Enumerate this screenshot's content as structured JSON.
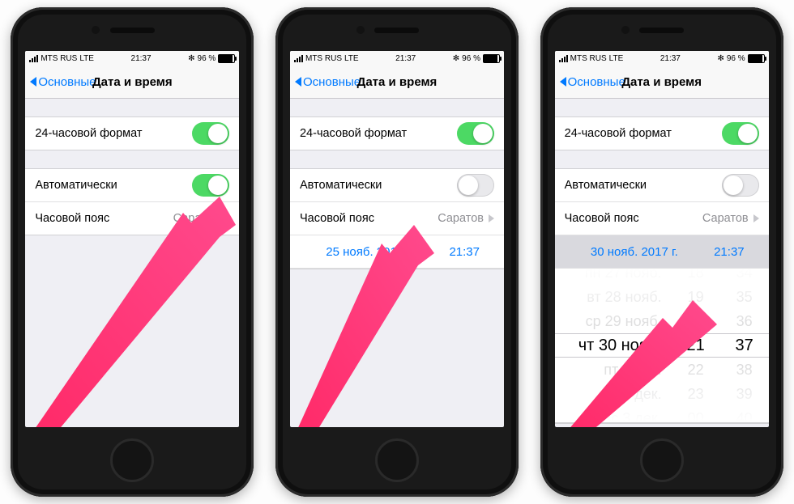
{
  "status_bar": {
    "carrier": "MTS RUS",
    "network": "LTE",
    "time": "21:37",
    "battery_pct": "96 %",
    "bluetooth": "✻"
  },
  "nav": {
    "back_label": "Основные",
    "title": "Дата и время"
  },
  "settings": {
    "twenty_four_hour_label": "24-часовой формат",
    "automatic_label": "Автоматически",
    "timezone_label": "Часовой пояс",
    "timezone_value": "Саратов"
  },
  "phone2_datetime": {
    "date": "25 нояб. 2017 г.",
    "time": "21:37"
  },
  "phone3_datetime": {
    "date": "30 нояб. 2017 г.",
    "time": "21:37"
  },
  "picker": {
    "dates": [
      "пн 27 нояб.",
      "вт 28 нояб.",
      "ср 29 нояб.",
      "чт 30 нояб.",
      "пт 1 дек.",
      "сб 2 дек.",
      "вс 3 дек."
    ],
    "hours": [
      "18",
      "19",
      "20",
      "21",
      "22",
      "23",
      "00"
    ],
    "minutes": [
      "34",
      "35",
      "36",
      "37",
      "38",
      "39",
      "40"
    ]
  }
}
